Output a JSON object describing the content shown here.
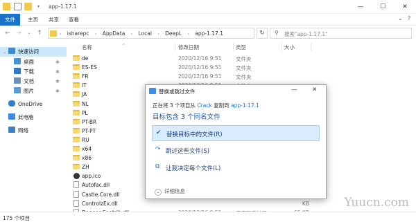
{
  "titlebar": {
    "title": "app-1.17.1",
    "controls": {
      "minimize": "—",
      "maximize": "☐",
      "close": "✕"
    }
  },
  "ribbon": {
    "tabs": [
      "文件",
      "主页",
      "共享",
      "查看"
    ],
    "expand": "⌄",
    "help": "?"
  },
  "address": {
    "crumbs": [
      "isharepc",
      "AppData",
      "Local",
      "DeepL",
      "app-1.17.1"
    ],
    "search_placeholder": "搜索\"app-1.17.1\""
  },
  "sidebar": {
    "items": [
      {
        "label": "快速访问",
        "icon": "star-icon",
        "selected": true,
        "pinned": false
      },
      {
        "label": "桌面",
        "icon": "desktop-icon",
        "pinned": true
      },
      {
        "label": "下载",
        "icon": "download-icon",
        "pinned": true
      },
      {
        "label": "文档",
        "icon": "document-icon",
        "pinned": true
      },
      {
        "label": "图片",
        "icon": "picture-icon",
        "pinned": true
      },
      {
        "label": "OneDrive",
        "icon": "cloud-icon",
        "pinned": false
      },
      {
        "label": "此电脑",
        "icon": "computer-icon",
        "pinned": false
      },
      {
        "label": "网络",
        "icon": "network-icon",
        "pinned": false
      }
    ]
  },
  "list": {
    "columns": {
      "name": "名称",
      "date": "修改日期",
      "type": "类型",
      "size": "大小"
    },
    "rows": [
      {
        "name": "de",
        "date": "2020/12/16 9:51",
        "type": "文件夹",
        "size": "",
        "kind": "folder"
      },
      {
        "name": "ES-ES",
        "date": "2020/12/16 9:51",
        "type": "文件夹",
        "size": "",
        "kind": "folder"
      },
      {
        "name": "FR",
        "date": "2020/12/16 9:51",
        "type": "文件夹",
        "size": "",
        "kind": "folder"
      },
      {
        "name": "IT",
        "date": "2020/12/16 9:51",
        "type": "文件夹",
        "size": "",
        "kind": "folder"
      },
      {
        "name": "JA",
        "date": "",
        "type": "",
        "size": "",
        "kind": "folder"
      },
      {
        "name": "NL",
        "date": "",
        "type": "",
        "size": "",
        "kind": "folder"
      },
      {
        "name": "PL",
        "date": "",
        "type": "",
        "size": "",
        "kind": "folder"
      },
      {
        "name": "PT-BR",
        "date": "",
        "type": "",
        "size": "",
        "kind": "folder"
      },
      {
        "name": "PT-PT",
        "date": "",
        "type": "",
        "size": "",
        "kind": "folder"
      },
      {
        "name": "RU",
        "date": "",
        "type": "",
        "size": "",
        "kind": "folder"
      },
      {
        "name": "x64",
        "date": "",
        "type": "",
        "size": "",
        "kind": "folder"
      },
      {
        "name": "x86",
        "date": "",
        "type": "",
        "size": "",
        "kind": "folder"
      },
      {
        "name": "ZH",
        "date": "",
        "type": "",
        "size": "",
        "kind": "folder"
      },
      {
        "name": "app.ico",
        "date": "",
        "type": "",
        "size": "KB",
        "kind": "app"
      },
      {
        "name": "Autofac.dll",
        "date": "",
        "type": "",
        "size": "KB",
        "kind": "file"
      },
      {
        "name": "Castle.Core.dll",
        "date": "",
        "type": "",
        "size": "KB",
        "kind": "file"
      },
      {
        "name": "ControlzEx.dll",
        "date": "",
        "type": "",
        "size": "KB",
        "kind": "file"
      },
      {
        "name": "Dapper.Contrib.dll",
        "date": "2020/12/16 9:51",
        "type": "应用程序扩展",
        "size": "65 KB",
        "kind": "file"
      }
    ]
  },
  "status": {
    "count": "175 个项目"
  },
  "watermark": "Yuucn.com",
  "dialog": {
    "title": "替换或跳过文件",
    "info_prefix": "正在将 3 个项目从 ",
    "info_source": "Crack",
    "info_middle": " 复制到 ",
    "info_dest": "app-1.17.1",
    "heading": "目标包含 3 个同名文件",
    "options": [
      {
        "label": "替换目标中的文件(R)",
        "icon": "check-icon",
        "glyph": "✔",
        "selected": true
      },
      {
        "label": "跳过这些文件(S)",
        "icon": "skip-icon",
        "glyph": "↷",
        "selected": false
      },
      {
        "label": "让我决定每个文件(L)",
        "icon": "compare-icon",
        "glyph": "⧉",
        "selected": false
      }
    ],
    "details": "详细信息",
    "minimize": "—",
    "close": "✕"
  }
}
